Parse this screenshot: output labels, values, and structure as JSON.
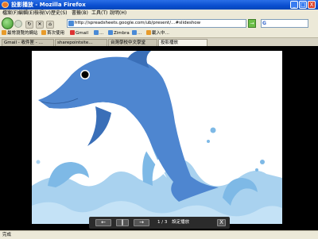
{
  "window": {
    "title": "投影播放 - Mozilla Firefox",
    "minimize": "_",
    "maximize": "□",
    "close": "X"
  },
  "menu": [
    "檔案(F)",
    "編輯(E)",
    "檢視(V)",
    "歷史(S)",
    "書籤(B)",
    "工具(T)",
    "說明(H)"
  ],
  "nav": {
    "url": "http://spreadsheets.google.com/ub/present/…#slideshow",
    "go": "→",
    "search_engine": "G"
  },
  "bookmarks": [
    "最常瀏覽的網站",
    "首次使用",
    "Gmail",
    "…",
    "Zimbra",
    "…",
    "載入中…"
  ],
  "tabs": [
    {
      "label": "Gmail - 收件匣 - …"
    },
    {
      "label": "sharepointsite…"
    },
    {
      "label": "台灣學校中文學堂"
    },
    {
      "label": "投影播放",
      "active": true
    }
  ],
  "controls": {
    "prev": "←",
    "pause": "‖",
    "next": "→",
    "page": "1 / 3",
    "label": "設定播放",
    "close": "X"
  },
  "status": "完成",
  "colors": {
    "titlebar": "#0a4fd0",
    "dolphin": "#4e86d0",
    "wave_light": "#a9d2ef",
    "wave_mid": "#7eb9e6"
  }
}
